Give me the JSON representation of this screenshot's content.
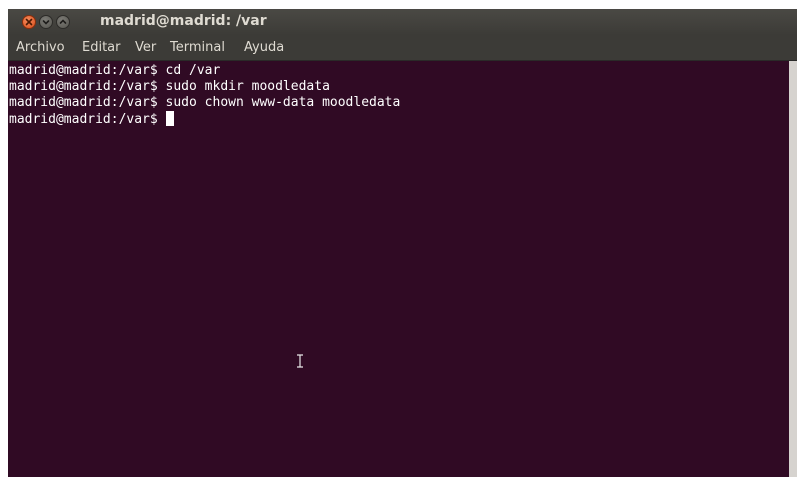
{
  "window": {
    "title": "madrid@madrid: /var",
    "buttons": [
      "close-icon",
      "minimize-icon",
      "maximize-icon"
    ]
  },
  "menu": {
    "items": [
      "Archivo",
      "Editar",
      "Ver",
      "Terminal",
      "Ayuda"
    ]
  },
  "terminal": {
    "lines": [
      "madrid@madrid:/var$ cd /var",
      "madrid@madrid:/var$ sudo mkdir moodledata",
      "madrid@madrid:/var$ sudo chown www-data moodledata",
      "madrid@madrid:/var$ "
    ]
  },
  "colors": {
    "terminal_bg": "#300a24",
    "terminal_fg": "#ffffff",
    "chrome": "#3c3b37",
    "close_button": "#e5622a"
  }
}
